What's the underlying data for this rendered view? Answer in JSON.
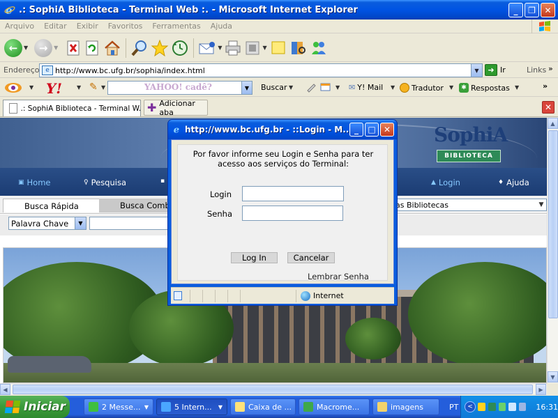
{
  "browser": {
    "title": ".: SophiA Biblioteca - Terminal Web :. - Microsoft Internet Explorer",
    "menu": [
      "Arquivo",
      "Editar",
      "Exibir",
      "Favoritos",
      "Ferramentas",
      "Ajuda"
    ],
    "address_label": "Endereço",
    "url": "http://www.bc.ufg.br/sophia/index.html",
    "go_label": "Ir",
    "links_label": "Links",
    "links_chevron": "»"
  },
  "yahoo_toolbar": {
    "logo": "Y!",
    "search_placeholder": "YAHOO! cadê?",
    "buscar": "Buscar",
    "mail": "Y! Mail",
    "tradutor": "Tradutor",
    "respostas": "Respostas",
    "chevron": "»"
  },
  "tabs": {
    "active_label": ".: SophiA Biblioteca - Terminal W...",
    "new_tab_label": "Adicionar aba"
  },
  "site": {
    "logo_word": "SophiA",
    "logo_sub": "BIBLIOTECA",
    "nav": {
      "home": "Home",
      "pesquisa": "Pesquisa",
      "login": "Login",
      "ajuda": "Ajuda"
    },
    "search_tabs": {
      "rapida": "Busca Rápida",
      "combinada": "Busca Combi"
    },
    "libraries_select": "as Bibliotecas",
    "keyword_select": "Palavra Chave",
    "keyword_value": ""
  },
  "popup": {
    "title": "http://www.bc.ufg.br - ::Login - M...",
    "message": "Por favor informe seu Login e Senha para ter acesso aos serviços do Terminal:",
    "login_label": "Login",
    "senha_label": "Senha",
    "login_value": "",
    "senha_value": "",
    "login_button": "Log In",
    "cancel_button": "Cancelar",
    "remember_link": "Lembrar Senha",
    "status_zone": "Internet"
  },
  "taskbar": {
    "start": "Iniciar",
    "items": [
      "2 Messe...",
      "5 Intern...",
      "Caixa de ...",
      "Macrome...",
      "imagens"
    ],
    "language": "PT",
    "clock": "16:31"
  },
  "colors": {
    "xp_blue": "#0054e3",
    "site_nav": "#1b3c73",
    "start_green": "#3c9c3c",
    "sophia_green": "#2e8a57"
  }
}
